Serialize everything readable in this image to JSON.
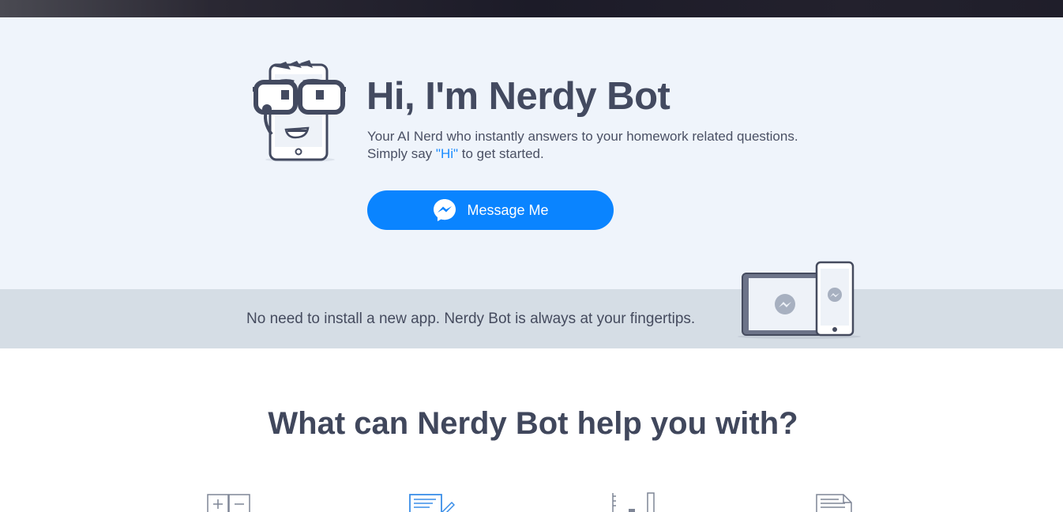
{
  "hero": {
    "title": "Hi, I'm Nerdy Bot",
    "desc_line1": "Your AI Nerd who instantly answers to your homework related questions.",
    "desc_line2_pre": "Simply say ",
    "desc_line2_hi": "\"Hi\"",
    "desc_line2_post": " to get started.",
    "button_label": "Message Me",
    "button_icon": "messenger-icon"
  },
  "band": {
    "text": "No need to install a new app. Nerdy Bot is always at your fingertips."
  },
  "features": {
    "title": "What can Nerdy Bot help you with?",
    "icons": [
      "math-operators-icon",
      "document-edit-icon",
      "ruler-icon",
      "paper-document-icon"
    ]
  },
  "colors": {
    "accent": "#0a84ff",
    "hero_bg": "#eff4fb",
    "band_bg": "#d5dde5",
    "heading": "#434a60"
  }
}
